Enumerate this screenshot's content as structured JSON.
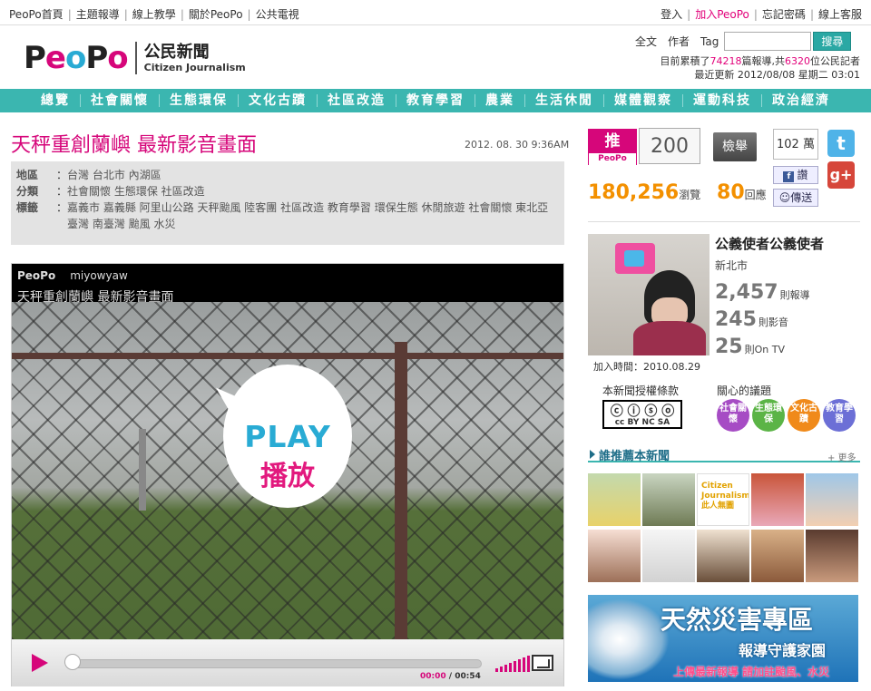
{
  "top_nav": {
    "left": [
      "PeoPo首頁",
      "主題報導",
      "線上教學",
      "關於PeoPo",
      "公共電視"
    ],
    "right": [
      "登入",
      "加入PeoPo",
      "忘記密碼",
      "線上客服"
    ]
  },
  "logo": {
    "brand": "PeoPo",
    "cn": "公民新聞",
    "en": "Citizen Journalism"
  },
  "search": {
    "options": [
      "全文",
      "作者",
      "Tag"
    ],
    "button": "搜尋",
    "placeholder": ""
  },
  "site_stats": {
    "line1_a": "目前累積了",
    "reports": "74218",
    "line1_b": "篇報導,共",
    "journalists": "6320",
    "line1_c": "位公民記者",
    "updated": "最近更新 2012/08/08 星期二 03:01"
  },
  "main_nav": [
    "總覽",
    "社會關懷",
    "生態環保",
    "文化古蹟",
    "社區改造",
    "教育學習",
    "農業",
    "生活休閒",
    "媒體觀察",
    "運動科技",
    "政治經濟"
  ],
  "article": {
    "title": "天秤重創蘭嶼 最新影音畫面",
    "date": "2012. 08. 30 9:36AM",
    "meta": {
      "region_label": "地區",
      "region": "台灣 台北市 內湖區",
      "category_label": "分類",
      "category": "社會關懷 生態環保 社區改造",
      "tags_label": "標籤",
      "tags": "嘉義市 嘉義縣 阿里山公路 天秤颱風 陸客團 社區改造 教育學習 環保生態 休閒旅遊 社會關懷 東北亞 臺灣 南臺灣 颱風 水災"
    }
  },
  "video": {
    "brand": "PeoPo",
    "author": "miyowyaw",
    "title": "天秤重創蘭嶼 最新影音畫面",
    "play_en": "PLAY",
    "play_cn": "播放",
    "time_current": "00:00",
    "time_total": "00:54",
    "progress": 0
  },
  "actions": {
    "push_label": "推",
    "push_sub": "PeoPo",
    "push_count": "200",
    "report_btn": "檢舉",
    "fb_count": "102 萬",
    "fb_like": "讚",
    "share": "傳送",
    "views": "180,256",
    "views_unit": "瀏覽",
    "replies": "80",
    "replies_unit": "回應"
  },
  "author": {
    "name": "公義使者公義使者",
    "location": "新北市",
    "reports": "2,457",
    "reports_unit": "則報導",
    "videos": "245",
    "videos_unit": "則影音",
    "ontv": "25",
    "ontv_unit": "則On TV",
    "joined": "加入時間：2010.08.29"
  },
  "license": {
    "label": "本新聞授權條款",
    "badge": "cc BY NC SA"
  },
  "topics": {
    "label": "關心的議題",
    "items": [
      {
        "text": "社會關懷",
        "color": "#a64cc4"
      },
      {
        "text": "生態環保",
        "color": "#5bb446"
      },
      {
        "text": "文化古蹟",
        "color": "#f08a1a"
      },
      {
        "text": "教育學習",
        "color": "#6c6fd6"
      }
    ]
  },
  "recommenders": {
    "title": "誰推薦本新聞",
    "more": "+ 更多",
    "thumb_text": [
      "",
      "",
      "Citizen Journalism 此人無圖",
      "",
      ""
    ]
  },
  "banner": {
    "title": "天然災害專區",
    "subtitle": "報導守護家園",
    "note": "上傳最新報導 請加註颱風、水災"
  },
  "colors": {
    "brand_pink": "#e2007a",
    "nav_teal": "#3bb6b0",
    "accent_orange": "#f39000"
  }
}
